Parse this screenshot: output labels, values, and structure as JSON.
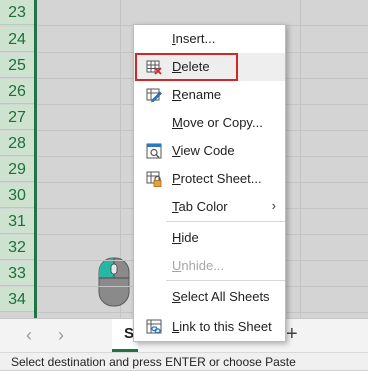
{
  "row_numbers": [
    "23",
    "24",
    "25",
    "26",
    "27",
    "28",
    "29",
    "30",
    "31",
    "32",
    "33",
    "34"
  ],
  "context_menu": {
    "items": [
      {
        "label": "Insert...",
        "underline_index": 0,
        "icon": "none"
      },
      {
        "label": "Delete",
        "underline_index": 0,
        "icon": "delete-sheet-icon"
      },
      {
        "label": "Rename",
        "underline_index": 0,
        "icon": "rename-sheet-icon"
      },
      {
        "label": "Move or Copy...",
        "underline_index": 0,
        "icon": "none"
      },
      {
        "label": "View Code",
        "underline_index": 0,
        "icon": "view-code-icon"
      },
      {
        "label": "Protect Sheet...",
        "underline_index": 0,
        "icon": "protect-sheet-icon"
      },
      {
        "label": "Tab Color",
        "underline_index": 0,
        "icon": "none",
        "submenu_glyph": "›"
      },
      {
        "label": "Hide",
        "underline_index": 0,
        "icon": "none"
      },
      {
        "label": "Unhide...",
        "underline_index": 0,
        "icon": "none",
        "disabled": true
      },
      {
        "label": "Select All Sheets",
        "underline_index": 0,
        "icon": "none"
      },
      {
        "label": "Link to this Sheet",
        "underline_index": 0,
        "icon": "link-sheet-icon"
      }
    ],
    "highlighted": "Delete"
  },
  "tabs": {
    "prev_glyph": "‹",
    "next_glyph": "›",
    "sheet_label": "S",
    "add_glyph": "+"
  },
  "status_bar": {
    "text": "Select destination and press ENTER or choose Paste"
  },
  "colors": {
    "accent": "#217346",
    "highlight_box": "#d1262a",
    "row_header_bg": "#cde3cf"
  }
}
